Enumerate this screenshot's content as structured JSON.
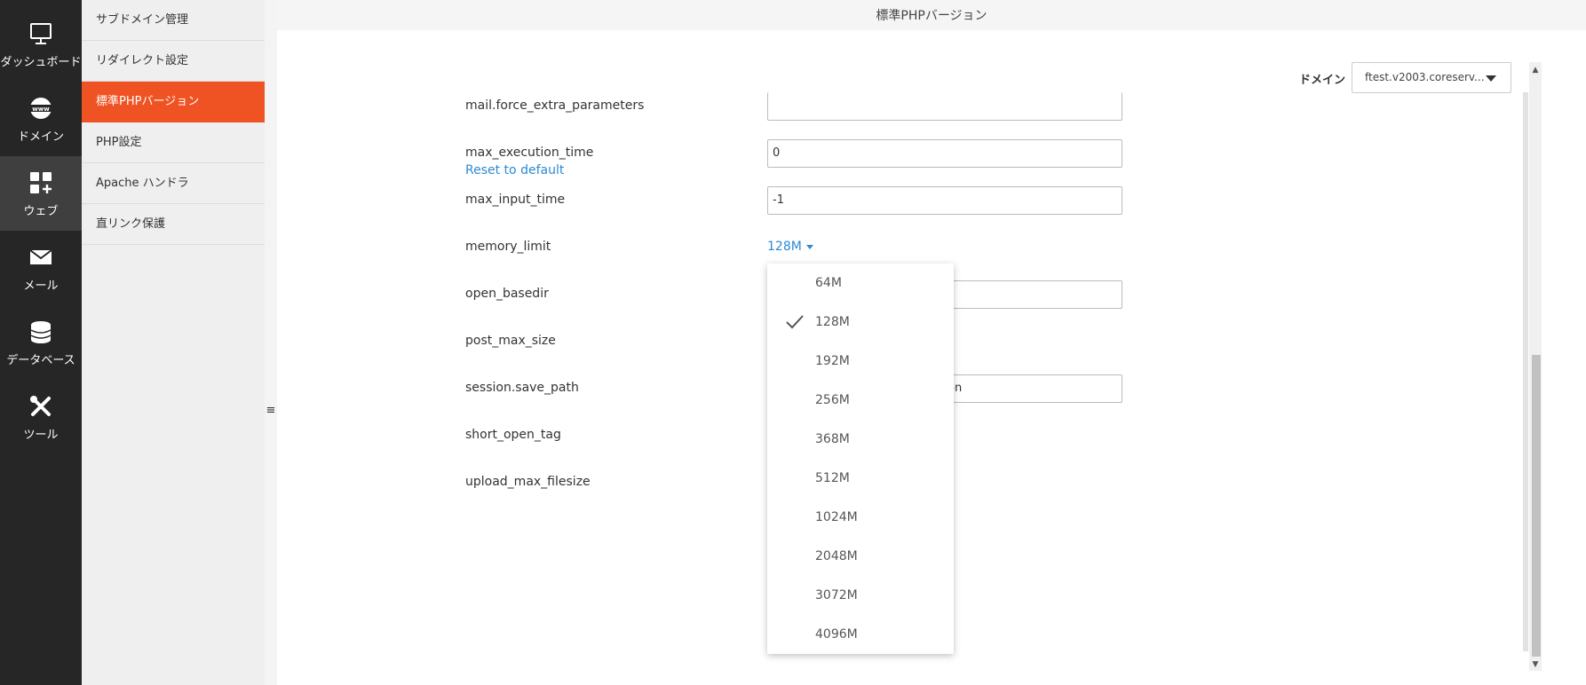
{
  "rail": {
    "items": [
      {
        "label": "ダッシュボード",
        "icon": "monitor-icon"
      },
      {
        "label": "ドメイン",
        "icon": "globe-www-icon"
      },
      {
        "label": "ウェブ",
        "icon": "grid-plus-icon"
      },
      {
        "label": "メール",
        "icon": "envelope-icon"
      },
      {
        "label": "データベース",
        "icon": "database-icon"
      },
      {
        "label": "ツール",
        "icon": "tools-icon"
      }
    ],
    "active_index": 2
  },
  "subnav": {
    "items": [
      {
        "label": "サブドメイン管理"
      },
      {
        "label": "リダイレクト設定"
      },
      {
        "label": "標準PHPバージョン"
      },
      {
        "label": "PHP設定"
      },
      {
        "label": "Apache ハンドラ"
      },
      {
        "label": "直リンク保護"
      }
    ],
    "active_index": 2
  },
  "header": {
    "title": "標準PHPバージョン"
  },
  "domain": {
    "label": "ドメイン",
    "selected": "ftest.v2003.coreserv..."
  },
  "form": {
    "rows": [
      {
        "name": "mail.force_extra_parameters",
        "value": ""
      },
      {
        "name": "max_execution_time",
        "value": "0",
        "reset": "Reset to default"
      },
      {
        "name": "max_input_time",
        "value": "-1"
      },
      {
        "name": "memory_limit",
        "value": "128M"
      },
      {
        "name": "open_basedir",
        "value": ""
      },
      {
        "name": "post_max_size",
        "value": ""
      },
      {
        "name": "session.save_path",
        "value": "on"
      },
      {
        "name": "short_open_tag",
        "value": ""
      },
      {
        "name": "upload_max_filesize",
        "value": ""
      }
    ]
  },
  "memory_dropdown": {
    "options": [
      "64M",
      "128M",
      "192M",
      "256M",
      "368M",
      "512M",
      "1024M",
      "2048M",
      "3072M",
      "4096M"
    ],
    "selected": "128M"
  },
  "colors": {
    "accent": "#f05323",
    "link": "#2a8ad4",
    "rail_bg": "#262626"
  }
}
